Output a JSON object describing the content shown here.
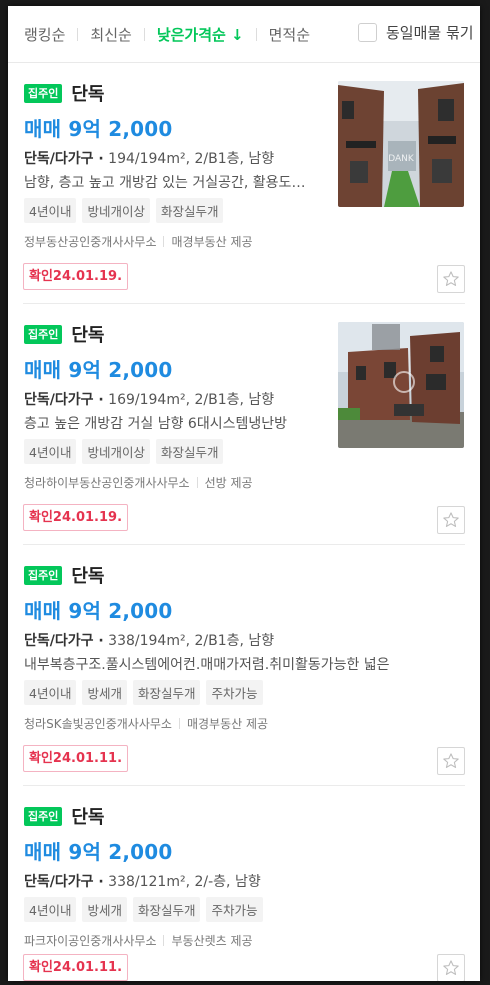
{
  "sort_bar": {
    "options": [
      {
        "label": "랭킹순",
        "active": false
      },
      {
        "label": "최신순",
        "active": false
      },
      {
        "label": "낮은가격순 ↓",
        "active": true
      },
      {
        "label": "면적순",
        "active": false
      }
    ],
    "same_listing_toggle": {
      "label": "동일매물 묶기",
      "checked": false
    }
  },
  "listings": [
    {
      "owner_badge": "집주인",
      "house_type": "단독",
      "price": "매매 9억 2,000",
      "spec_type": "단독/다가구 ·",
      "spec_detail": "194/194m², 2/B1층, 남향",
      "description": "남향, 층고 높고 개방감 있는 거실공간, 활용도 높은",
      "tags": [
        "4년이내",
        "방네개이상",
        "화장실두개"
      ],
      "agency": "정부동산공인중개사사무소",
      "provider": "매경부동산 제공",
      "confirmed": "확인24.01.19.",
      "favorite_icon": "star-outline-icon",
      "thumbnail": "brick-houses-photo"
    },
    {
      "owner_badge": "집주인",
      "house_type": "단독",
      "price": "매매 9억 2,000",
      "spec_type": "단독/다가구 ·",
      "spec_detail": "169/194m², 2/B1층, 남향",
      "description": "층고 높은 개방감 거실 남향 6대시스템냉난방",
      "tags": [
        "4년이내",
        "방네개이상",
        "화장실두개"
      ],
      "agency": "청라하이부동산공인중개사사무소",
      "provider": "선방 제공",
      "confirmed": "확인24.01.19.",
      "favorite_icon": "star-outline-icon",
      "thumbnail": "brick-house-exterior-photo"
    },
    {
      "owner_badge": "집주인",
      "house_type": "단독",
      "price": "매매 9억 2,000",
      "spec_type": "단독/다가구 ·",
      "spec_detail": "338/194m², 2/B1층, 남향",
      "description": "내부복층구조.풀시스템에어컨.매매가저렴.취미활동가능한 넓은",
      "tags": [
        "4년이내",
        "방세개",
        "화장실두개",
        "주차가능"
      ],
      "agency": "청라SK솔빛공인중개사사무소",
      "provider": "매경부동산 제공",
      "confirmed": "확인24.01.11.",
      "favorite_icon": "star-outline-icon",
      "thumbnail": null
    },
    {
      "owner_badge": "집주인",
      "house_type": "단독",
      "price": "매매 9억 2,000",
      "spec_type": "단독/다가구 ·",
      "spec_detail": "338/121m², 2/-층, 남향",
      "description": null,
      "tags": [
        "4년이내",
        "방세개",
        "화장실두개",
        "주차가능"
      ],
      "agency": "파크자이공인중개사사무소",
      "provider": "부동산렛츠 제공",
      "confirmed": "확인24.01.11.",
      "favorite_icon": "star-outline-icon",
      "thumbnail": null
    }
  ],
  "colors": {
    "accent_green": "#03c75a",
    "price_blue": "#1f8be0",
    "confirm_red": "#e5334f"
  }
}
